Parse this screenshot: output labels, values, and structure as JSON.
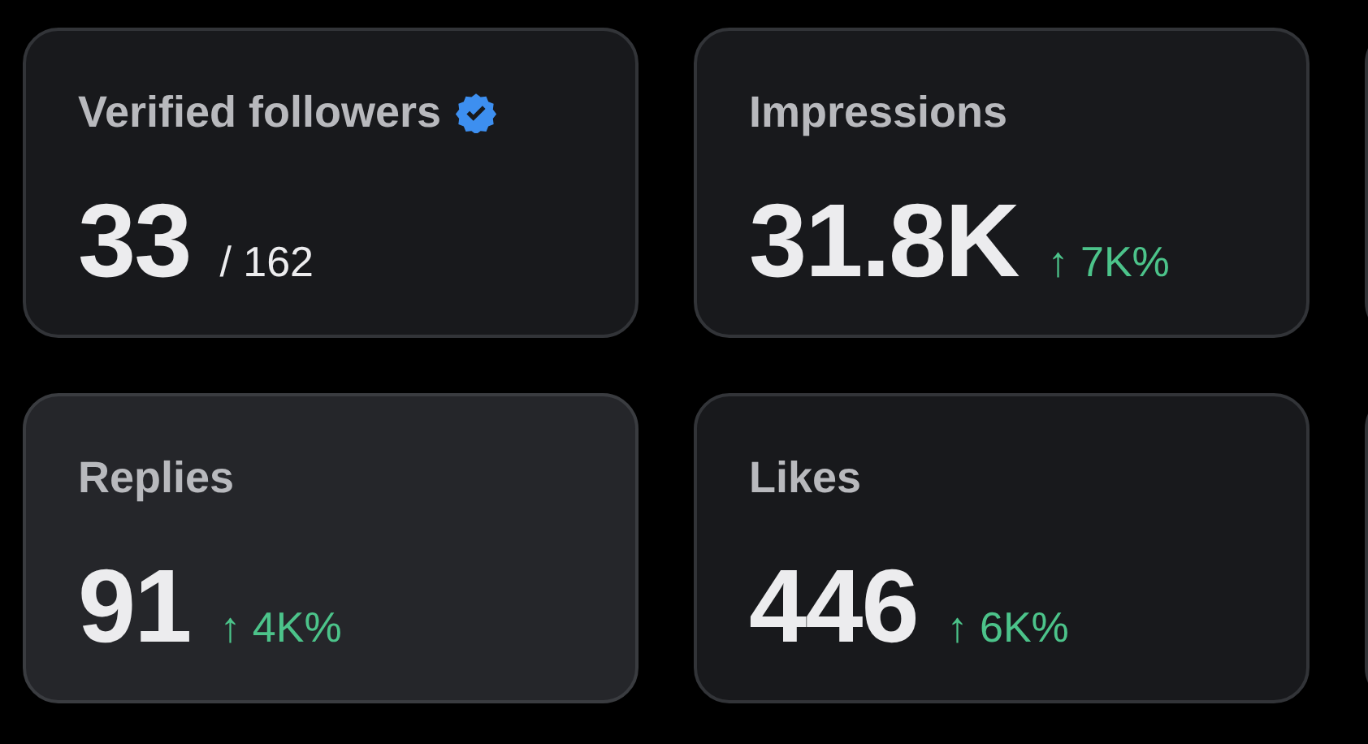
{
  "cards": [
    {
      "label": "Verified followers",
      "verified": true,
      "value": "33",
      "suffix": "/ 162",
      "selected": false
    },
    {
      "label": "Impressions",
      "verified": false,
      "value": "31.8K",
      "delta": "↑ 7K%",
      "selected": false
    },
    {
      "label": "Replies",
      "verified": false,
      "value": "91",
      "delta": "↑ 4K%",
      "selected": true
    },
    {
      "label": "Likes",
      "verified": false,
      "value": "446",
      "delta": "↑ 6K%",
      "selected": false
    }
  ]
}
